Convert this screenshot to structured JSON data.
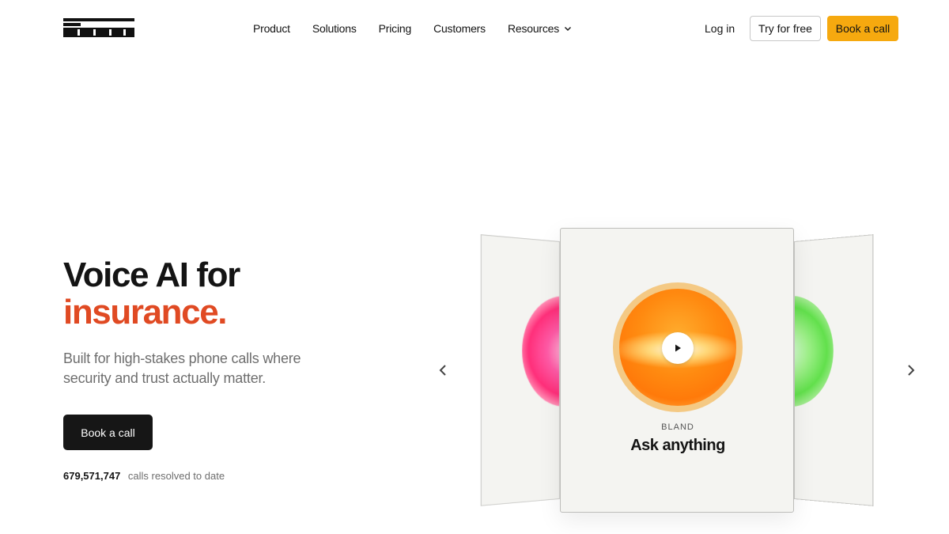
{
  "nav": {
    "logo_text": "bland",
    "menu": [
      {
        "label": "Product"
      },
      {
        "label": "Solutions"
      },
      {
        "label": "Pricing"
      },
      {
        "label": "Customers"
      },
      {
        "label": "Resources",
        "has_dropdown": true
      }
    ],
    "login": "Log in",
    "try_free": "Try for free",
    "book_call": "Book a call"
  },
  "hero": {
    "title_line1": "Voice AI for",
    "title_line2": "insurance.",
    "subtitle": "Built for high-stakes phone calls where security and trust actually matter.",
    "cta": "Book a call",
    "stat_number": "679,571,747",
    "stat_label": "calls resolved to date"
  },
  "carousel": {
    "card_brand": "BLAND",
    "card_title": "Ask anything"
  },
  "colors": {
    "accent": "#e04a23",
    "cta_yellow": "#f6a90f",
    "dark_button": "#161616"
  },
  "icons": {
    "dropdown": "chevron-down-icon",
    "play": "play-icon",
    "prev": "chevron-left-icon",
    "next": "chevron-right-icon"
  }
}
